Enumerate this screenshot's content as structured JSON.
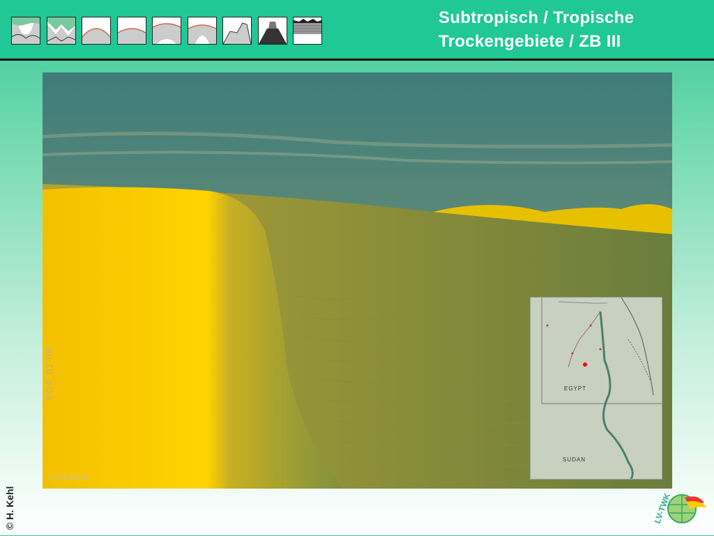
{
  "header": {
    "title": "Subtropisch / Tropische\nTrockengebiete / ZB III",
    "zonobiome_icons": [
      "zb-1-icon",
      "zb-2-icon",
      "zb-3-icon",
      "zb-4-icon",
      "zb-5-icon",
      "zb-6-icon",
      "zb-7-icon",
      "zb-8-icon",
      "zb-9-icon"
    ],
    "active_zone": "ZB III"
  },
  "photo": {
    "code": "EG4_01-05",
    "credit": "© H.Kehl",
    "map": {
      "labels": [
        "EGYPT",
        "SUDAN"
      ],
      "marker_color": "#ff0000"
    }
  },
  "footer": {
    "copyright": "© H. Kehl",
    "logo_text": "LV-TWK"
  },
  "colors": {
    "header_bg": "#1fc894",
    "title_text": "#ffffff",
    "sand": "#f5c800"
  }
}
